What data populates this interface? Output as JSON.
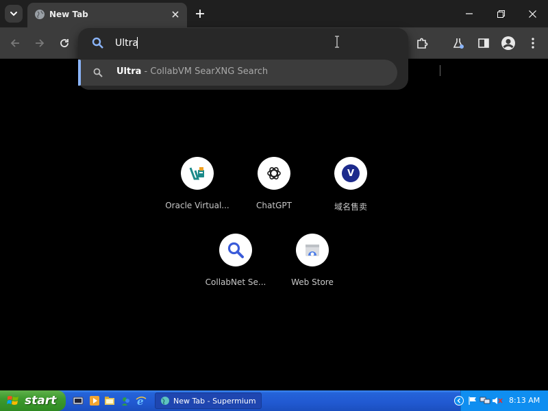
{
  "browser": {
    "tab": {
      "title": "New Tab"
    },
    "omnibox": {
      "value": "Ultra",
      "suggestion": {
        "query": "Ultra",
        "rest": " - CollabVM SearXNG Search"
      }
    },
    "icons": {
      "tab_search": "chevron-down-icon",
      "favicon": "globe-icon",
      "back": "arrow-left-icon",
      "forward": "arrow-right-icon",
      "reload": "reload-icon",
      "extensions": "puzzle-icon",
      "labs": "flask-icon",
      "side_panel": "side-panel-icon",
      "profile": "profile-icon",
      "menu": "kebab-menu-icon"
    }
  },
  "shortcuts": [
    {
      "label": "Oracle Virtual...",
      "icon": "virtualbox-icon"
    },
    {
      "label": "ChatGPT",
      "icon": "openai-icon"
    },
    {
      "label": "域名售卖",
      "icon": "letter-v-icon",
      "letter": "V"
    },
    {
      "label": "CollabNet Se...",
      "icon": "magnifier-icon"
    },
    {
      "label": "Web Store",
      "icon": "webstore-icon"
    }
  ],
  "taskbar": {
    "start_label": "start",
    "task_label": "New Tab - Supermium",
    "clock": "8:13 AM"
  },
  "colors": {
    "accent": "#8ab4f8",
    "toolbar": "#3c3c3c",
    "tabstrip": "#1f1f1f",
    "page_bg": "#000000",
    "taskbar_blue": "#2159d1",
    "start_green": "#3d9a2e"
  }
}
